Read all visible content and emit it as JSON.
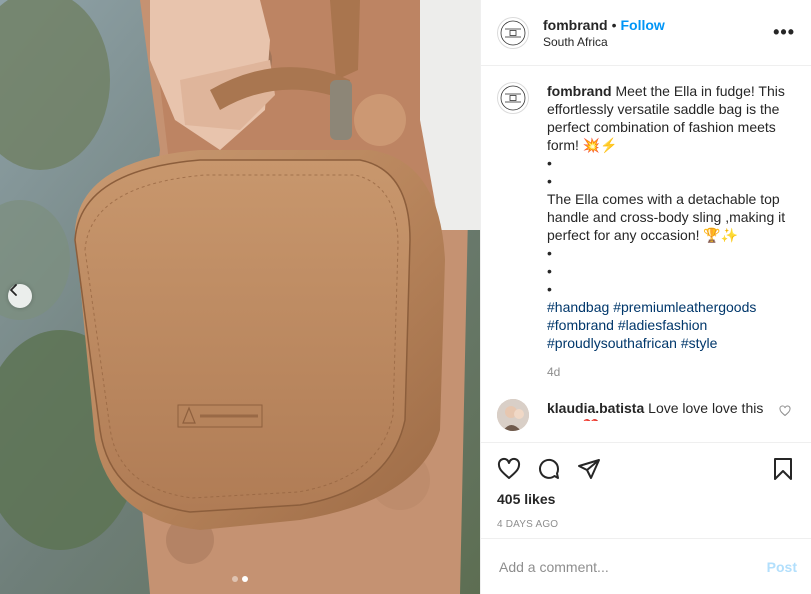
{
  "post": {
    "username": "fombrand",
    "separator": "•",
    "follow_label": "Follow",
    "location": "South Africa",
    "more_label": "•••"
  },
  "caption": {
    "username": "fombrand",
    "line1": "Meet the Ella in fudge! This effortlessly versatile saddle bag is the perfect combination of fashion meets form! 💥⚡",
    "bullet": "•",
    "line2": "The Ella comes with a detachable top handle and cross-body sling ,making it perfect for any occasion! 🏆✨",
    "hashtags": [
      "#handbag",
      "#premiumleathergoods",
      "#fombrand",
      "#ladiesfashion",
      "#proudlysouthafrican",
      "#style"
    ],
    "time": "4d"
  },
  "comment": {
    "username": "klaudia.batista",
    "text": "Love love love this bag!! ❤️"
  },
  "stats": {
    "likes": "405 likes",
    "date": "4 DAYS AGO"
  },
  "composer": {
    "placeholder": "Add a comment...",
    "post_label": "Post"
  },
  "carousel": {
    "count": 2,
    "active": 2
  },
  "icons": {
    "like": "heart-icon",
    "comment": "comment-icon",
    "share": "share-icon",
    "save": "bookmark-icon",
    "prev": "chevron-left-icon"
  },
  "colors": {
    "accent": "#0095f6",
    "hashtag": "#00376b",
    "muted": "#8e8e8e",
    "post_disabled": "#b2dffc"
  }
}
